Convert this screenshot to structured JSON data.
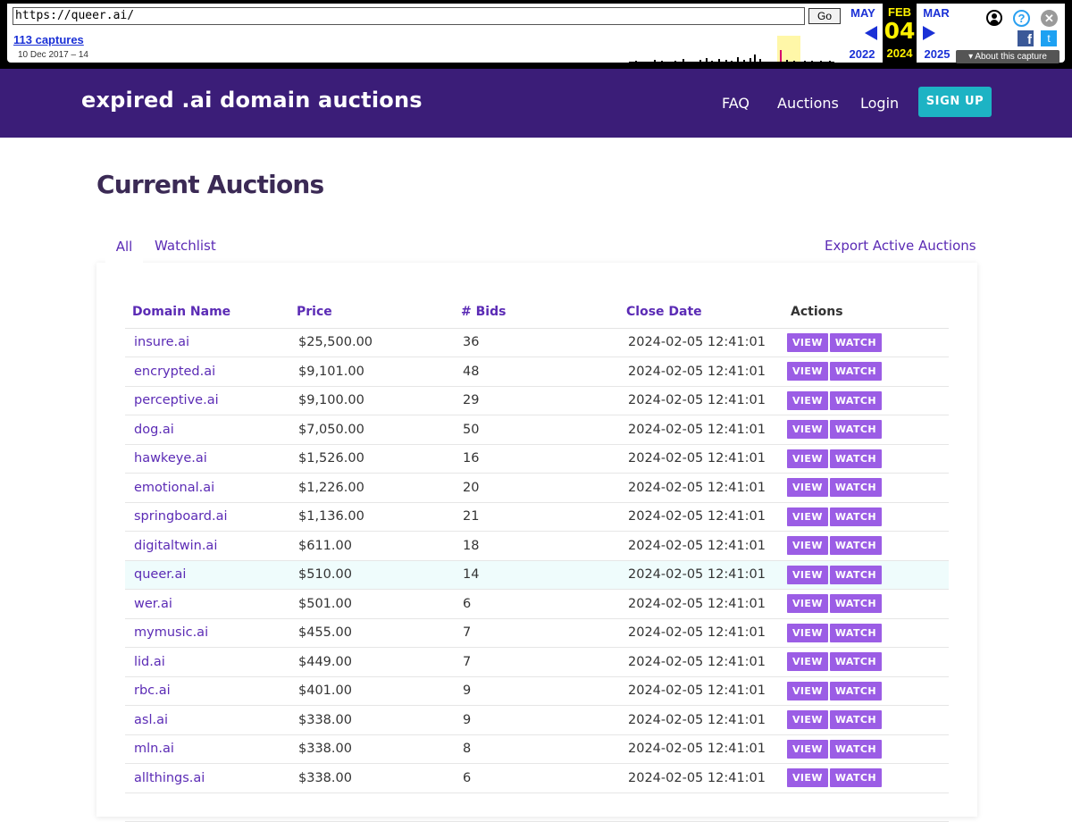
{
  "wayback": {
    "url": "https://queer.ai/",
    "go_label": "Go",
    "captures": "113 captures",
    "date_range": "10 Dec 2017 – 14",
    "prev_month": "MAY",
    "prev_year": "2022",
    "cur_month": "FEB",
    "cur_day": "04",
    "cur_year": "2024",
    "next_month": "MAR",
    "next_year": "2025",
    "about": "About this capture",
    "help_glyph": "?",
    "close_glyph": "✕",
    "facebook_glyph": "f",
    "twitter_glyph": "t"
  },
  "header": {
    "brand": "expired .ai domain auctions",
    "nav": [
      "FAQ",
      "Auctions",
      "Login"
    ],
    "signup": "SIGN UP"
  },
  "main": {
    "title": "Current Auctions",
    "tabs": [
      "All",
      "Watchlist"
    ],
    "export": "Export Active Auctions",
    "columns": [
      "Domain Name",
      "Price",
      "# Bids",
      "Close Date",
      "Actions"
    ],
    "view_label": "VIEW",
    "watch_label": "WATCH",
    "rows": [
      {
        "domain": "insure.ai",
        "price": "$25,500.00",
        "bids": "36",
        "close": "2024-02-05 12:41:01"
      },
      {
        "domain": "encrypted.ai",
        "price": "$9,101.00",
        "bids": "48",
        "close": "2024-02-05 12:41:01"
      },
      {
        "domain": "perceptive.ai",
        "price": "$9,100.00",
        "bids": "29",
        "close": "2024-02-05 12:41:01"
      },
      {
        "domain": "dog.ai",
        "price": "$7,050.00",
        "bids": "50",
        "close": "2024-02-05 12:41:01"
      },
      {
        "domain": "hawkeye.ai",
        "price": "$1,526.00",
        "bids": "16",
        "close": "2024-02-05 12:41:01"
      },
      {
        "domain": "emotional.ai",
        "price": "$1,226.00",
        "bids": "20",
        "close": "2024-02-05 12:41:01"
      },
      {
        "domain": "springboard.ai",
        "price": "$1,136.00",
        "bids": "21",
        "close": "2024-02-05 12:41:01"
      },
      {
        "domain": "digitaltwin.ai",
        "price": "$611.00",
        "bids": "18",
        "close": "2024-02-05 12:41:01"
      },
      {
        "domain": "queer.ai",
        "price": "$510.00",
        "bids": "14",
        "close": "2024-02-05 12:41:01",
        "highlight": true
      },
      {
        "domain": "wer.ai",
        "price": "$501.00",
        "bids": "6",
        "close": "2024-02-05 12:41:01"
      },
      {
        "domain": "mymusic.ai",
        "price": "$455.00",
        "bids": "7",
        "close": "2024-02-05 12:41:01"
      },
      {
        "domain": "lid.ai",
        "price": "$449.00",
        "bids": "7",
        "close": "2024-02-05 12:41:01"
      },
      {
        "domain": "rbc.ai",
        "price": "$401.00",
        "bids": "9",
        "close": "2024-02-05 12:41:01"
      },
      {
        "domain": "asl.ai",
        "price": "$338.00",
        "bids": "9",
        "close": "2024-02-05 12:41:01"
      },
      {
        "domain": "mln.ai",
        "price": "$338.00",
        "bids": "8",
        "close": "2024-02-05 12:41:01"
      },
      {
        "domain": "allthings.ai",
        "price": "$338.00",
        "bids": "6",
        "close": "2024-02-05 12:41:01"
      },
      {
        "domain": "",
        "price": "",
        "bids": "",
        "close": ""
      }
    ]
  },
  "colors": {
    "header_bg": "#3b1d78",
    "accent": "#5b2bb5",
    "button": "#9b5de5",
    "signup": "#1db3c4",
    "highlight_row": "#effcfc"
  }
}
